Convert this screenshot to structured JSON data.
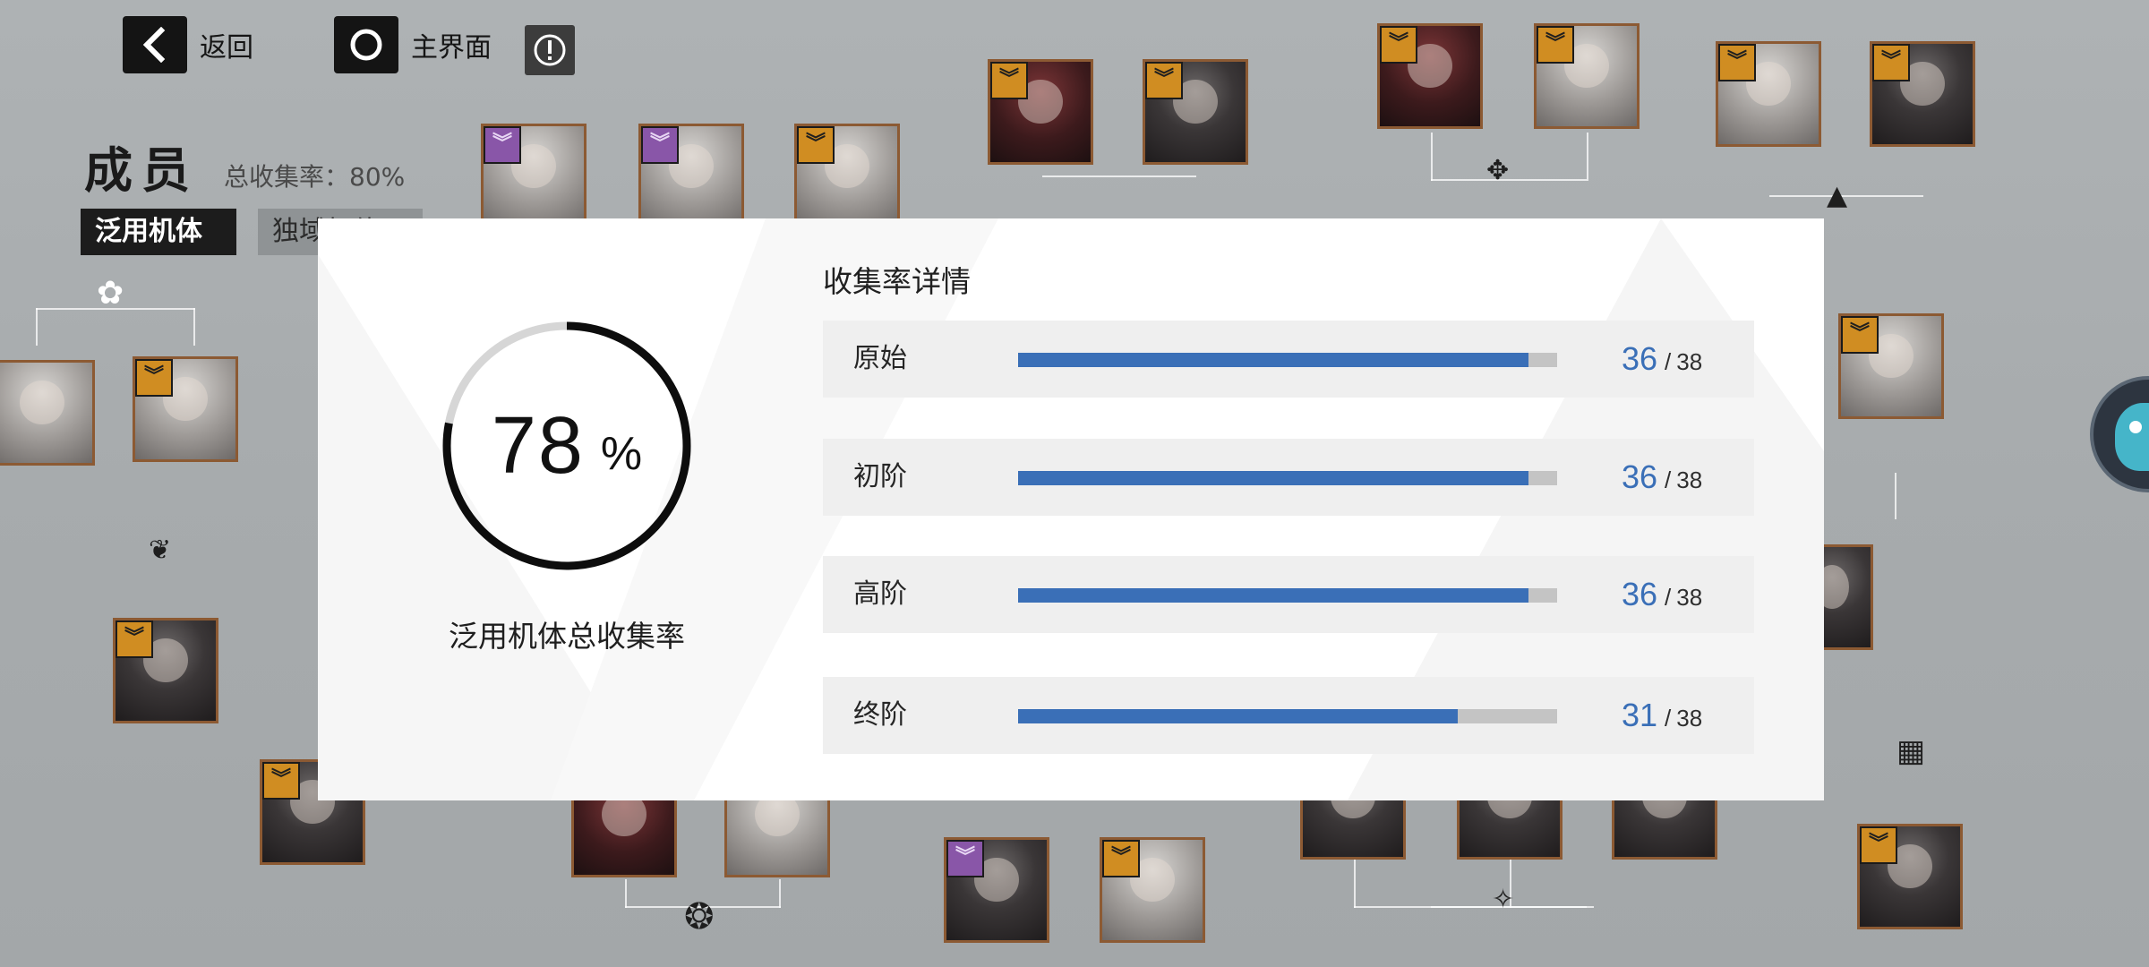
{
  "nav": {
    "back_label": "返回",
    "home_label": "主界面"
  },
  "members": {
    "title": "成员",
    "total_rate_label": "总收集率：",
    "total_rate_value": "80%",
    "tabs": [
      {
        "label": "泛用机体",
        "active": true
      },
      {
        "label": "独域机体",
        "active": false
      }
    ]
  },
  "modal": {
    "percent_value": "78",
    "percent_unit": "%",
    "ring_fraction": 0.78,
    "caption": "泛用机体总收集率",
    "detail_title": "收集率详情",
    "rows": [
      {
        "label": "原始",
        "current": "36",
        "separator": "/",
        "total": "38"
      },
      {
        "label": "初阶",
        "current": "36",
        "separator": "/",
        "total": "38"
      },
      {
        "label": "高阶",
        "current": "36",
        "separator": "/",
        "total": "38"
      },
      {
        "label": "终阶",
        "current": "31",
        "separator": "/",
        "total": "38"
      }
    ]
  },
  "colors": {
    "accent_blue": "#3a6fb7",
    "badge_gold": "#d08d22",
    "badge_purple": "#8956a8",
    "ring_stroke": "#0d0d0d",
    "ring_track": "#d6d6d6"
  },
  "icons": {
    "back": "chevron-left-icon",
    "home": "circle-icon",
    "info": "exclamation-circle-icon",
    "rank_badge": "double-chevron-down-icon",
    "faction": "faction-emblem-icon"
  }
}
